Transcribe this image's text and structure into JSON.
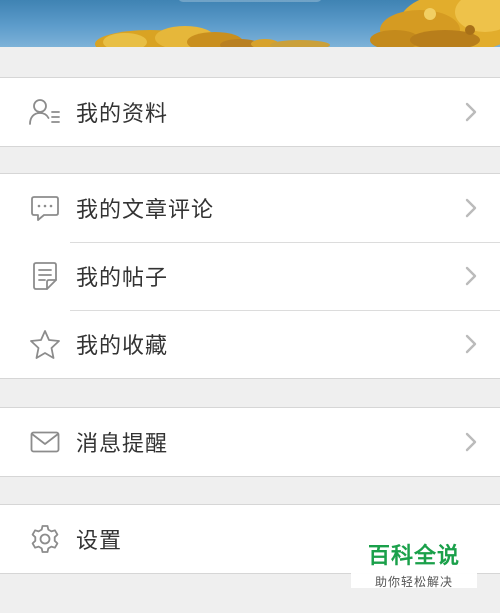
{
  "colors": {
    "background": "#efefef",
    "row_bg": "#ffffff",
    "icon": "#8c8c8c",
    "label": "#333333",
    "chevron": "#bbbbbb",
    "watermark_green": "#1aa04a"
  },
  "menu": {
    "profile": {
      "label": "我的资料",
      "icon": "user-list-icon"
    },
    "comments": {
      "label": "我的文章评论",
      "icon": "chat-bubble-icon"
    },
    "posts": {
      "label": "我的帖子",
      "icon": "edit-document-icon"
    },
    "favorites": {
      "label": "我的收藏",
      "icon": "star-icon"
    },
    "notifications": {
      "label": "消息提醒",
      "icon": "envelope-icon"
    },
    "settings": {
      "label": "设置",
      "icon": "gear-icon"
    }
  },
  "watermark": {
    "title": "百科全说",
    "subtitle": "助你轻松解决"
  }
}
